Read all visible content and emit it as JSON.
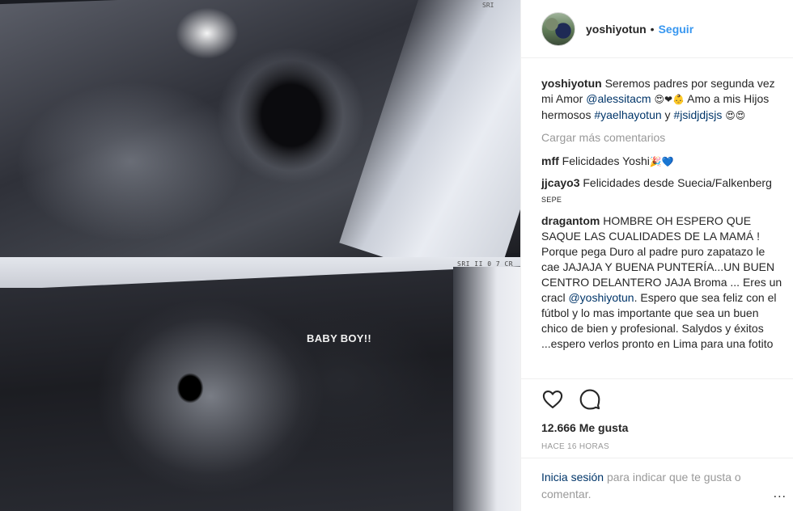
{
  "post": {
    "photo": {
      "label": "BABY BOY!!",
      "tiny_top": "SRI",
      "tiny_bottom": "SRI II 0 7 CR"
    },
    "header": {
      "username": "yoshiyotun",
      "separator": "•",
      "follow_label": "Seguir"
    },
    "caption": {
      "username": "yoshiyotun",
      "text_1": "Seremos padres por segunda vez mi Amor",
      "mention": "@alessitacm",
      "emoji_1": "😍❤👶",
      "text_2": "Amo a mis Hijos hermosos",
      "hashtag_1": "#yaelhayotun",
      "text_3": "y",
      "hashtag_2": "#jsidjdjsjs",
      "emoji_2": "😍😍"
    },
    "load_more": "Cargar más comentarios",
    "comments": [
      {
        "username": "mff",
        "text": "Felicidades Yoshi",
        "emoji": "🎉💙"
      },
      {
        "username": "jjcayo3",
        "text": "Felicidades desde Suecia/Falkenberg",
        "tag": "SEPE"
      },
      {
        "username": "dragantom",
        "text_1": "HOMBRE OH ESPERO QUE SAQUE LAS CUALIDADES DE LA MAMÁ ! Porque pega Duro al padre puro zapatazo le cae JAJAJA Y BUENA PUNTERÍA...UN BUEN CENTRO DELANTERO JAJA Broma ... Eres un cracl",
        "mention": "@yoshiyotun",
        "text_2": ". Espero que sea feliz con el fútbol y lo mas importante que sea un buen chico de bien y profesional. Salydos y éxitos ...espero verlos pronto en Lima para una fotito"
      }
    ],
    "actions": {
      "like_icon": "heart-icon",
      "comment_icon": "comment-bubble-icon",
      "likes": "12.666 Me gusta",
      "time": "HACE 16 HORAS"
    },
    "login": {
      "link": "Inicia sesión",
      "text": "para indicar que te gusta o comentar.",
      "more": "..."
    },
    "colors": {
      "link_blue": "#3897f0",
      "mention_blue": "#003569",
      "muted_gray": "#999999",
      "text": "#262626"
    }
  }
}
